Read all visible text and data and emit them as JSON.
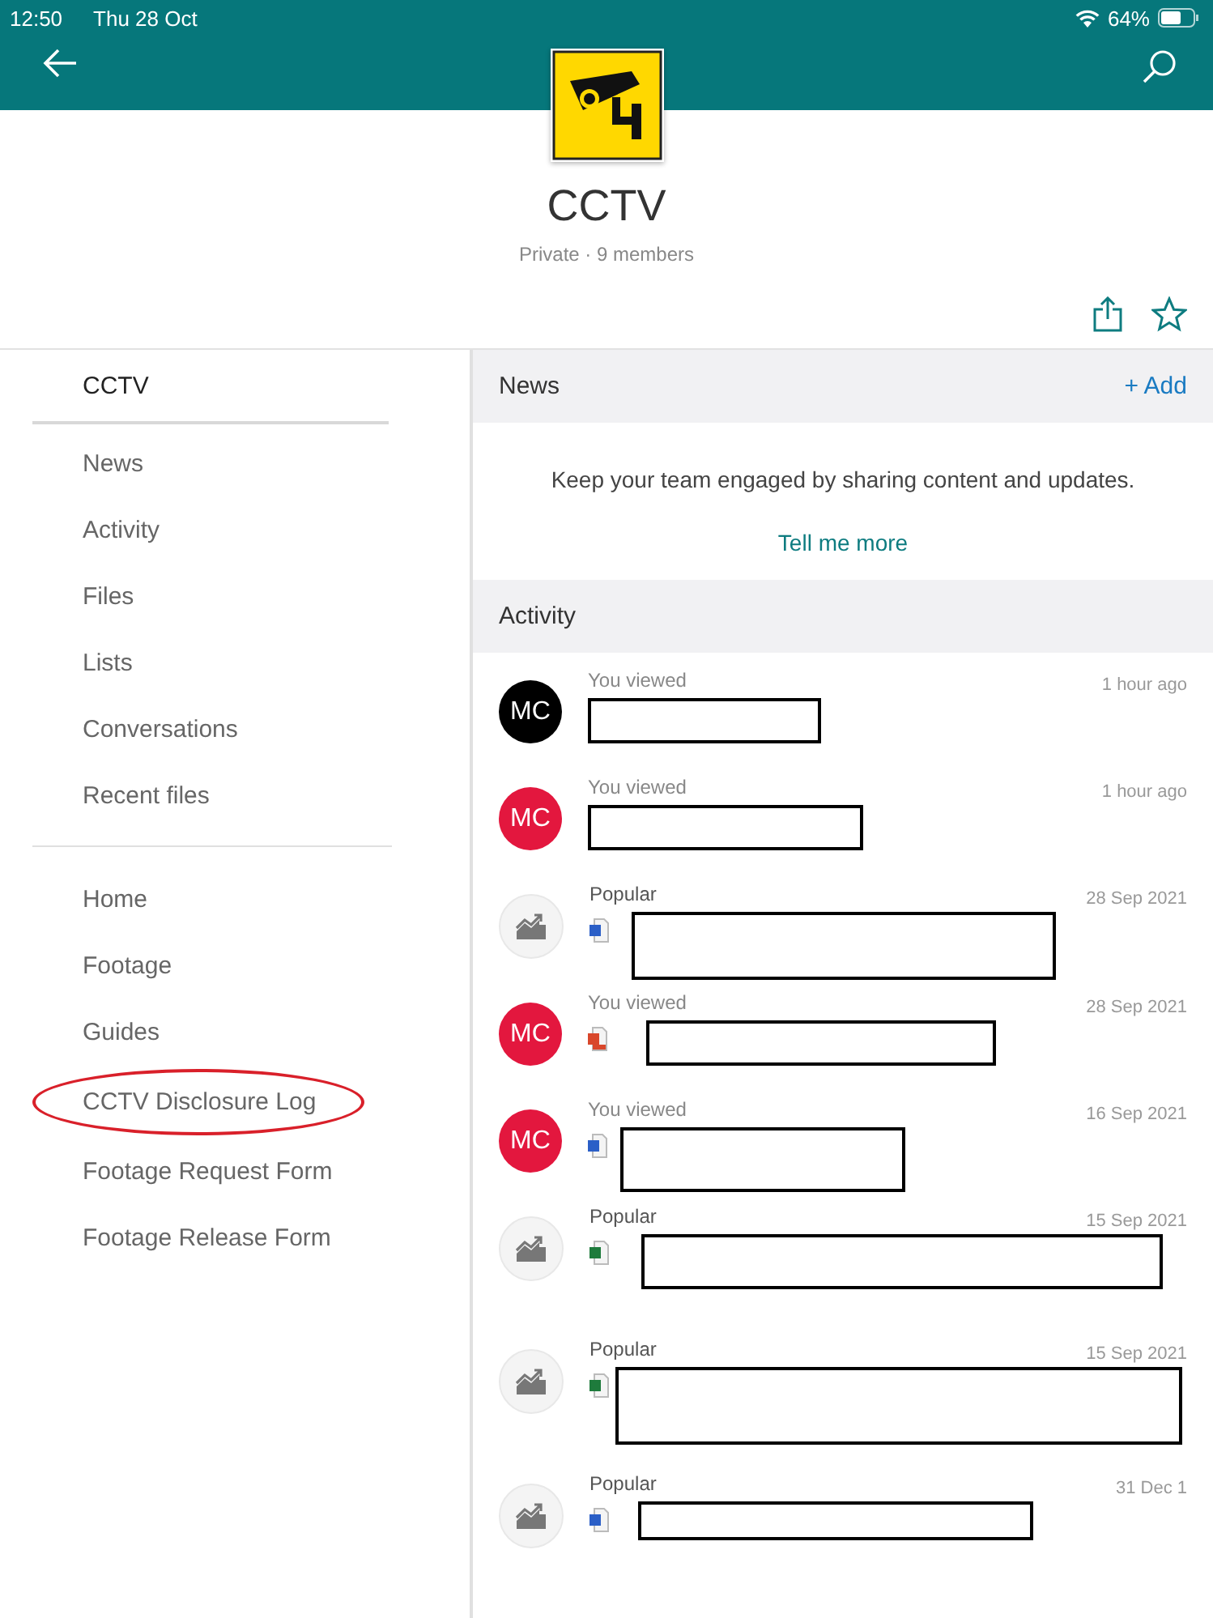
{
  "status_bar": {
    "time": "12:50",
    "date": "Thu 28 Oct",
    "battery": "64%"
  },
  "group": {
    "name": "CCTV",
    "subtitle": "Private · 9 members"
  },
  "sidebar": {
    "title": "CCTV",
    "items": [
      {
        "label": "News",
        "highlighted": false
      },
      {
        "label": "Activity",
        "highlighted": false
      },
      {
        "label": "Files",
        "highlighted": false
      },
      {
        "label": "Lists",
        "highlighted": false
      },
      {
        "label": "Conversations",
        "highlighted": false
      },
      {
        "label": "Recent files",
        "highlighted": false
      }
    ],
    "links": [
      {
        "label": "Home",
        "highlighted": false
      },
      {
        "label": "Footage",
        "highlighted": false
      },
      {
        "label": "Guides",
        "highlighted": false
      },
      {
        "label": "CCTV Disclosure Log",
        "highlighted": true
      },
      {
        "label": "Footage Request Form",
        "highlighted": false
      },
      {
        "label": "Footage Release Form",
        "highlighted": false
      }
    ]
  },
  "news": {
    "title": "News",
    "add": "+ Add",
    "message": "Keep your team engaged by sharing content and updates.",
    "link": "Tell me more"
  },
  "activity": {
    "title": "Activity",
    "items": [
      {
        "kind": "person",
        "initials": "MC",
        "color": "#000000",
        "action": "You viewed",
        "time": "1 hour ago"
      },
      {
        "kind": "person",
        "initials": "MC",
        "color": "#e3173e",
        "action": "You viewed",
        "time": "1 hour ago"
      },
      {
        "kind": "popular",
        "action": "Popular",
        "time": "28 Sep 2021",
        "file": {
          "kind": "word"
        }
      },
      {
        "kind": "person",
        "initials": "MC",
        "color": "#e3173e",
        "action": "You viewed",
        "time": "28 Sep 2021",
        "file": {
          "kind": "pdf"
        }
      },
      {
        "kind": "person",
        "initials": "MC",
        "color": "#e3173e",
        "action": "You viewed",
        "time": "16 Sep 2021",
        "file": {
          "kind": "word"
        }
      },
      {
        "kind": "popular",
        "action": "Popular",
        "time": "15 Sep 2021",
        "file": {
          "kind": "excel"
        }
      },
      {
        "kind": "popular",
        "action": "Popular",
        "time": "15 Sep 2021",
        "file": {
          "kind": "excel"
        }
      },
      {
        "kind": "popular",
        "action": "Popular",
        "time": "31 Dec 1",
        "file": {
          "kind": "word"
        }
      }
    ]
  }
}
